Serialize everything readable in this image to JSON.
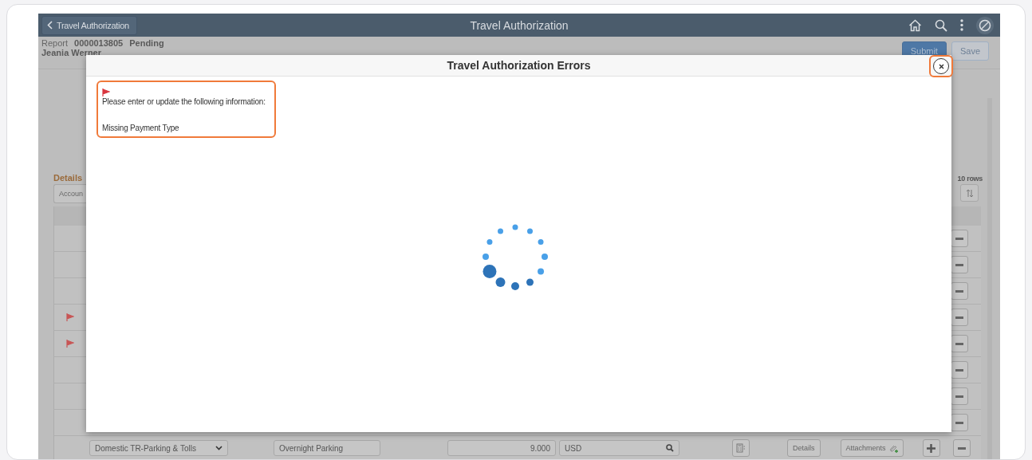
{
  "header": {
    "back_label": "Travel Authorization",
    "title": "Travel Authorization"
  },
  "report": {
    "label": "Report",
    "number": "0000013805",
    "status": "Pending",
    "employee": "Jeania Werner"
  },
  "actions": [
    {
      "label": "Submit",
      "kind": "primary"
    },
    {
      "label": "Save",
      "kind": "secondary"
    }
  ],
  "details": {
    "title": "Details",
    "tab": "Accoun",
    "row_count": "10 rows"
  },
  "rows": [
    {
      "flagged": false
    },
    {
      "flagged": false
    },
    {
      "flagged": false
    },
    {
      "flagged": true
    },
    {
      "flagged": true
    },
    {
      "flagged": false
    },
    {
      "flagged": false
    },
    {
      "flagged": false
    }
  ],
  "last_row": {
    "expense_type": "Domestic TR-Parking & Tolls",
    "description": "Overnight Parking",
    "amount": "9.000",
    "currency": "USD",
    "details_button": "Details",
    "attachments_button": "Attachments"
  },
  "dialog": {
    "title": "Travel Authorization Errors",
    "message": "Please enter or update the following information:",
    "errors": [
      "Missing Payment Type"
    ]
  }
}
